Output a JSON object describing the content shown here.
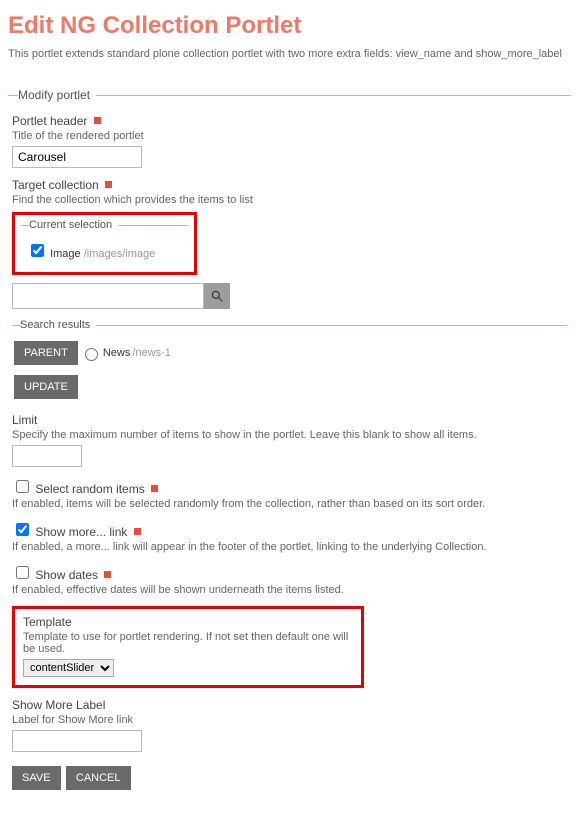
{
  "page": {
    "title": "Edit NG Collection Portlet",
    "description": "This portlet extends standard plone collection portlet with two more extra fields: view_name and show_more_label"
  },
  "form": {
    "legend": "Modify portlet",
    "portletHeader": {
      "label": "Portlet header",
      "help": "Title of the rendered portlet",
      "value": "Carousel"
    },
    "targetCollection": {
      "label": "Target collection",
      "help": "Find the collection which provides the items to list"
    },
    "currentSelection": {
      "legend": "Current selection",
      "itemChecked": true,
      "itemName": "Image",
      "itemPath": "/images/image"
    },
    "search": {
      "value": ""
    },
    "searchResults": {
      "legend": "Search results",
      "parentLabel": "PARENT",
      "itemName": "News",
      "itemPath": "/news-1",
      "updateLabel": "UPDATE"
    },
    "limit": {
      "label": "Limit",
      "help": "Specify the maximum number of items to show in the portlet. Leave this blank to show all items.",
      "value": ""
    },
    "randomItems": {
      "label": "Select random items",
      "help": "If enabled, items will be selected randomly from the collection, rather than based on its sort order.",
      "checked": false
    },
    "showMoreLink": {
      "label": "Show more... link",
      "help": "If enabled, a more... link will appear in the footer of the portlet, linking to the underlying Collection.",
      "checked": true
    },
    "showDates": {
      "label": "Show dates",
      "help": "If enabled, effective dates will be shown underneath the items listed.",
      "checked": false
    },
    "template": {
      "label": "Template",
      "help": "Template to use for portlet rendering. If not set then default one will be used.",
      "value": "contentSlider"
    },
    "showMoreLabel": {
      "label": "Show More Label",
      "help": "Label for Show More link",
      "value": ""
    },
    "actions": {
      "save": "SAVE",
      "cancel": "CANCEL"
    }
  }
}
